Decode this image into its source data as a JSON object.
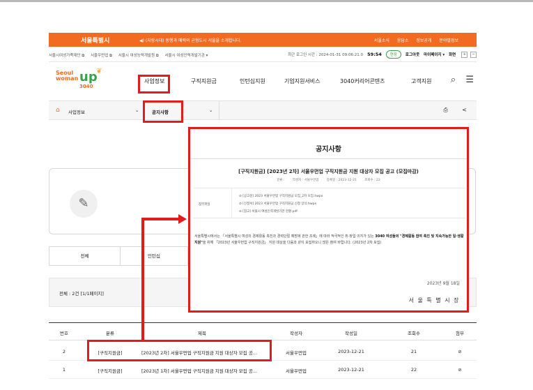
{
  "topbar": {
    "logo": "서울특별시",
    "notice": "◀) (자랑시대) 동행과 매력의 균형도시 서울을 소개합니다.",
    "links": [
      "서울소식",
      "응답소",
      "정보공개",
      "분야별정보"
    ]
  },
  "sitebar": {
    "sites": [
      "서울시여성가족재단 ⧉",
      "서울우먼업 ⧉",
      "서울시 여성능력개발원 ⧉",
      "서울시 여성인력개발기관 ▾"
    ],
    "last_login": "최근 로그인 시간 : 2024-01-31 09:06:21.0",
    "timer": "59:54",
    "extend_label": "연장",
    "logout_label": "로그아웃",
    "mypage_label": "마이페이지 ▾",
    "zoom_label": "화면",
    "zoom_in": "+",
    "zoom_out": "−"
  },
  "brand": {
    "line1": "Seoul",
    "line2": "woman",
    "line3": "up",
    "line4": "3040"
  },
  "nav": {
    "items": [
      "사업정보",
      "구직지원금",
      "인턴십지원",
      "기업지원서비스",
      "3040커리어콘텐츠",
      "고객지원"
    ],
    "search_icon": "⌕",
    "menu_icon": "☰"
  },
  "breadcrumb": {
    "home_icon": "⌂",
    "level1": "사업정보",
    "level2": "공지사항",
    "chevron": "⌄",
    "print_icon": "⎙",
    "share_icon": "<"
  },
  "page": {
    "pencil_icon": "✎",
    "tab_all": "전체",
    "tab_intern": "인턴십",
    "count_label": "전체 : 2건 [1/1페이지]"
  },
  "table": {
    "headers": [
      "번호",
      "분류",
      "제목",
      "작성자",
      "작성일",
      "조회수",
      "첨부"
    ],
    "rows": [
      {
        "no": "2",
        "category": "[구직지원금]",
        "title": "[2023년 2차] 서울우먼업 구직지원금 지원 대상자 모집 공...",
        "author": "서울우먼업",
        "date": "2023-12-21",
        "views": "21",
        "attach": "⊘"
      },
      {
        "no": "1",
        "category": "[구직지원금]",
        "title": "[2023년 1차] 서울우먼업 구직지원금 지원 대상자 모집 공...",
        "author": "서울우먼업",
        "date": "2023-12-21",
        "views": "22",
        "attach": "⊘"
      }
    ]
  },
  "overlay": {
    "title": "공지사항",
    "subtitle": "[구직지원금] [2023년 2차] 서울우먼업 구직지원금 지원 대상자 모집 공고 (모집마감)",
    "meta": [
      "분류 :",
      "작성자 : 서울우먼업",
      "등록일 : 2023-12-21",
      "조회수 : 22"
    ],
    "attach_label": "첨부파일",
    "files": [
      "[공고문] 2023 서울우먼업 구직지원금 모집_2차 모집.hwpx",
      "[신청서] 2023 서울우먼업 구직지원금 신청 양식.hwpx",
      "[참고] 서울시 여성인력개발기관 현황.pdf"
    ],
    "body_1": "서울특별시에서는 「서울특별시 여성의 경제활동 촉진과 경력단절 예방에 관한 조례」에 따라 적극적인 취·창업 의지가 있는 ",
    "body_bold_1": "3040 여성들의 \"경제활동 참여 촉진 및 지속가능한 일·생활 지원\"",
    "body_2": "을 위해 「2023년 서울우먼업 구직지원금」 지원 대상을 다음과 같이 모집하오니 많은 참여 바랍니다. (2023년 2차 모집)",
    "date": "2023년 9월 18일",
    "sign": "서 울 특 별 시 장"
  }
}
